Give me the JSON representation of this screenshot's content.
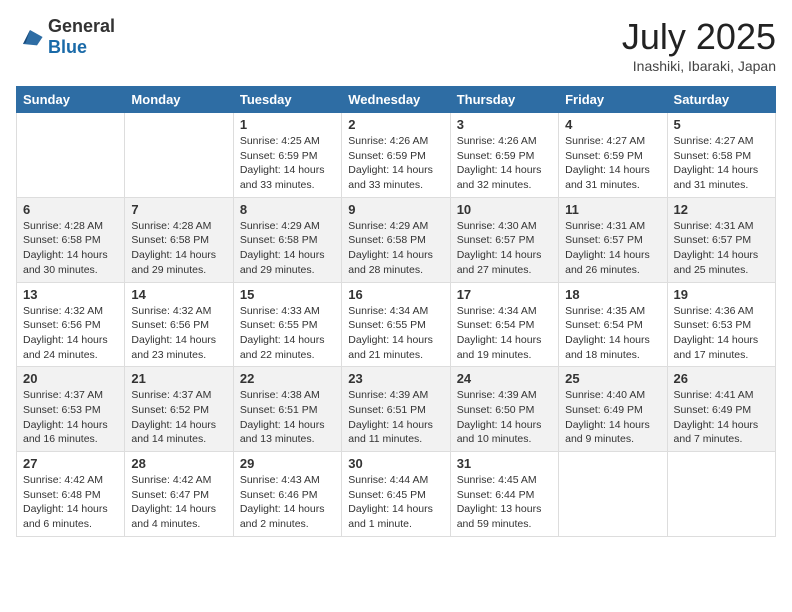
{
  "header": {
    "logo_general": "General",
    "logo_blue": "Blue",
    "month_year": "July 2025",
    "location": "Inashiki, Ibaraki, Japan"
  },
  "days_of_week": [
    "Sunday",
    "Monday",
    "Tuesday",
    "Wednesday",
    "Thursday",
    "Friday",
    "Saturday"
  ],
  "weeks": [
    [
      {
        "day": "",
        "sunrise": "",
        "sunset": "",
        "daylight": ""
      },
      {
        "day": "",
        "sunrise": "",
        "sunset": "",
        "daylight": ""
      },
      {
        "day": "1",
        "sunrise": "Sunrise: 4:25 AM",
        "sunset": "Sunset: 6:59 PM",
        "daylight": "Daylight: 14 hours and 33 minutes."
      },
      {
        "day": "2",
        "sunrise": "Sunrise: 4:26 AM",
        "sunset": "Sunset: 6:59 PM",
        "daylight": "Daylight: 14 hours and 33 minutes."
      },
      {
        "day": "3",
        "sunrise": "Sunrise: 4:26 AM",
        "sunset": "Sunset: 6:59 PM",
        "daylight": "Daylight: 14 hours and 32 minutes."
      },
      {
        "day": "4",
        "sunrise": "Sunrise: 4:27 AM",
        "sunset": "Sunset: 6:59 PM",
        "daylight": "Daylight: 14 hours and 31 minutes."
      },
      {
        "day": "5",
        "sunrise": "Sunrise: 4:27 AM",
        "sunset": "Sunset: 6:58 PM",
        "daylight": "Daylight: 14 hours and 31 minutes."
      }
    ],
    [
      {
        "day": "6",
        "sunrise": "Sunrise: 4:28 AM",
        "sunset": "Sunset: 6:58 PM",
        "daylight": "Daylight: 14 hours and 30 minutes."
      },
      {
        "day": "7",
        "sunrise": "Sunrise: 4:28 AM",
        "sunset": "Sunset: 6:58 PM",
        "daylight": "Daylight: 14 hours and 29 minutes."
      },
      {
        "day": "8",
        "sunrise": "Sunrise: 4:29 AM",
        "sunset": "Sunset: 6:58 PM",
        "daylight": "Daylight: 14 hours and 29 minutes."
      },
      {
        "day": "9",
        "sunrise": "Sunrise: 4:29 AM",
        "sunset": "Sunset: 6:58 PM",
        "daylight": "Daylight: 14 hours and 28 minutes."
      },
      {
        "day": "10",
        "sunrise": "Sunrise: 4:30 AM",
        "sunset": "Sunset: 6:57 PM",
        "daylight": "Daylight: 14 hours and 27 minutes."
      },
      {
        "day": "11",
        "sunrise": "Sunrise: 4:31 AM",
        "sunset": "Sunset: 6:57 PM",
        "daylight": "Daylight: 14 hours and 26 minutes."
      },
      {
        "day": "12",
        "sunrise": "Sunrise: 4:31 AM",
        "sunset": "Sunset: 6:57 PM",
        "daylight": "Daylight: 14 hours and 25 minutes."
      }
    ],
    [
      {
        "day": "13",
        "sunrise": "Sunrise: 4:32 AM",
        "sunset": "Sunset: 6:56 PM",
        "daylight": "Daylight: 14 hours and 24 minutes."
      },
      {
        "day": "14",
        "sunrise": "Sunrise: 4:32 AM",
        "sunset": "Sunset: 6:56 PM",
        "daylight": "Daylight: 14 hours and 23 minutes."
      },
      {
        "day": "15",
        "sunrise": "Sunrise: 4:33 AM",
        "sunset": "Sunset: 6:55 PM",
        "daylight": "Daylight: 14 hours and 22 minutes."
      },
      {
        "day": "16",
        "sunrise": "Sunrise: 4:34 AM",
        "sunset": "Sunset: 6:55 PM",
        "daylight": "Daylight: 14 hours and 21 minutes."
      },
      {
        "day": "17",
        "sunrise": "Sunrise: 4:34 AM",
        "sunset": "Sunset: 6:54 PM",
        "daylight": "Daylight: 14 hours and 19 minutes."
      },
      {
        "day": "18",
        "sunrise": "Sunrise: 4:35 AM",
        "sunset": "Sunset: 6:54 PM",
        "daylight": "Daylight: 14 hours and 18 minutes."
      },
      {
        "day": "19",
        "sunrise": "Sunrise: 4:36 AM",
        "sunset": "Sunset: 6:53 PM",
        "daylight": "Daylight: 14 hours and 17 minutes."
      }
    ],
    [
      {
        "day": "20",
        "sunrise": "Sunrise: 4:37 AM",
        "sunset": "Sunset: 6:53 PM",
        "daylight": "Daylight: 14 hours and 16 minutes."
      },
      {
        "day": "21",
        "sunrise": "Sunrise: 4:37 AM",
        "sunset": "Sunset: 6:52 PM",
        "daylight": "Daylight: 14 hours and 14 minutes."
      },
      {
        "day": "22",
        "sunrise": "Sunrise: 4:38 AM",
        "sunset": "Sunset: 6:51 PM",
        "daylight": "Daylight: 14 hours and 13 minutes."
      },
      {
        "day": "23",
        "sunrise": "Sunrise: 4:39 AM",
        "sunset": "Sunset: 6:51 PM",
        "daylight": "Daylight: 14 hours and 11 minutes."
      },
      {
        "day": "24",
        "sunrise": "Sunrise: 4:39 AM",
        "sunset": "Sunset: 6:50 PM",
        "daylight": "Daylight: 14 hours and 10 minutes."
      },
      {
        "day": "25",
        "sunrise": "Sunrise: 4:40 AM",
        "sunset": "Sunset: 6:49 PM",
        "daylight": "Daylight: 14 hours and 9 minutes."
      },
      {
        "day": "26",
        "sunrise": "Sunrise: 4:41 AM",
        "sunset": "Sunset: 6:49 PM",
        "daylight": "Daylight: 14 hours and 7 minutes."
      }
    ],
    [
      {
        "day": "27",
        "sunrise": "Sunrise: 4:42 AM",
        "sunset": "Sunset: 6:48 PM",
        "daylight": "Daylight: 14 hours and 6 minutes."
      },
      {
        "day": "28",
        "sunrise": "Sunrise: 4:42 AM",
        "sunset": "Sunset: 6:47 PM",
        "daylight": "Daylight: 14 hours and 4 minutes."
      },
      {
        "day": "29",
        "sunrise": "Sunrise: 4:43 AM",
        "sunset": "Sunset: 6:46 PM",
        "daylight": "Daylight: 14 hours and 2 minutes."
      },
      {
        "day": "30",
        "sunrise": "Sunrise: 4:44 AM",
        "sunset": "Sunset: 6:45 PM",
        "daylight": "Daylight: 14 hours and 1 minute."
      },
      {
        "day": "31",
        "sunrise": "Sunrise: 4:45 AM",
        "sunset": "Sunset: 6:44 PM",
        "daylight": "Daylight: 13 hours and 59 minutes."
      },
      {
        "day": "",
        "sunrise": "",
        "sunset": "",
        "daylight": ""
      },
      {
        "day": "",
        "sunrise": "",
        "sunset": "",
        "daylight": ""
      }
    ]
  ]
}
